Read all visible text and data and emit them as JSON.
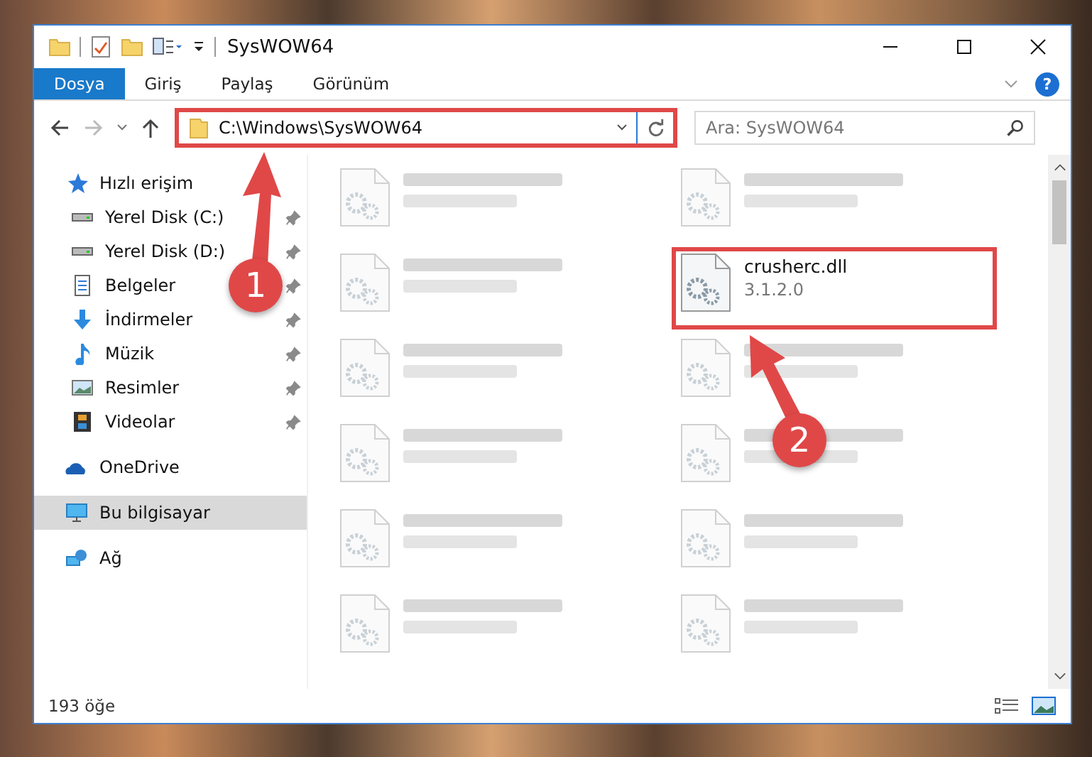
{
  "window": {
    "title": "SysWOW64"
  },
  "help_button": "?",
  "ribbon_tabs": [
    {
      "label": "Dosya",
      "selected": true
    },
    {
      "label": "Giriş",
      "selected": false
    },
    {
      "label": "Paylaş",
      "selected": false
    },
    {
      "label": "Görünüm",
      "selected": false
    }
  ],
  "address": {
    "path": "C:\\Windows\\SysWOW64",
    "highlighted": true
  },
  "search": {
    "placeholder": "Ara: SysWOW64"
  },
  "sidebar": {
    "items": [
      {
        "label": "Hızlı erişim",
        "kind": "star",
        "selected": false,
        "children": [
          {
            "label": "Yerel Disk (C:)",
            "kind": "drive",
            "pinned": true
          },
          {
            "label": "Yerel Disk (D:)",
            "kind": "drive",
            "pinned": true
          },
          {
            "label": "Belgeler",
            "kind": "document",
            "pinned": true
          },
          {
            "label": "İndirmeler",
            "kind": "download",
            "pinned": true
          },
          {
            "label": "Müzik",
            "kind": "music",
            "pinned": true
          },
          {
            "label": "Resimler",
            "kind": "pictures",
            "pinned": true
          },
          {
            "label": "Videolar",
            "kind": "video",
            "pinned": true
          }
        ]
      },
      {
        "label": "OneDrive",
        "kind": "cloud",
        "selected": false
      },
      {
        "label": "Bu bilgisayar",
        "kind": "computer",
        "selected": true
      },
      {
        "label": "Ağ",
        "kind": "network",
        "selected": false
      }
    ]
  },
  "files": [
    {
      "blurred": true,
      "highlighted": false
    },
    {
      "blurred": true,
      "highlighted": false
    },
    {
      "blurred": true,
      "highlighted": false
    },
    {
      "name": "crusherc.dll",
      "detail": "3.1.2.0",
      "blurred": false,
      "highlighted": true
    },
    {
      "blurred": true,
      "highlighted": false
    },
    {
      "blurred": true,
      "highlighted": false
    },
    {
      "blurred": true,
      "highlighted": false
    },
    {
      "blurred": true,
      "highlighted": false
    },
    {
      "blurred": true,
      "highlighted": false
    },
    {
      "blurred": true,
      "highlighted": false
    },
    {
      "blurred": true,
      "highlighted": false
    },
    {
      "blurred": true,
      "highlighted": false
    }
  ],
  "status_bar": {
    "item_count": "193 öğe"
  },
  "annotations": [
    {
      "number": "1"
    },
    {
      "number": "2"
    }
  ]
}
